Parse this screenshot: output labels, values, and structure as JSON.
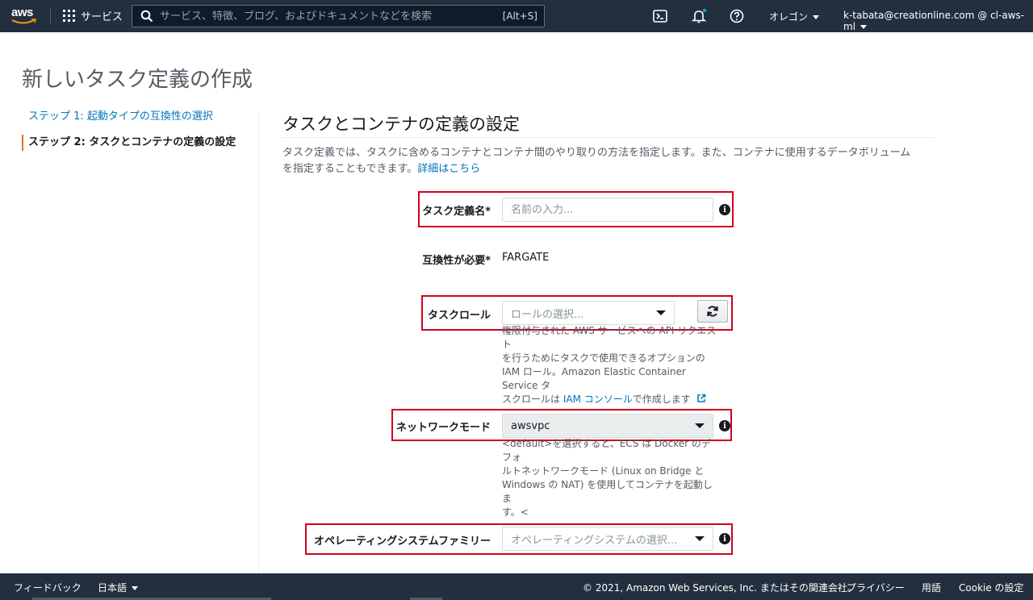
{
  "nav": {
    "logo_text": "aws",
    "services_label": "サービス",
    "search_placeholder": "サービス、特徴、ブログ、およびドキュメントなどを検索",
    "search_shortcut": "[Alt+S]",
    "region": "オレゴン",
    "account": "k-tabata@creationline.com @ cl-aws-ml",
    "icons": [
      "cloudshell-icon",
      "notifications-bell-icon",
      "help-icon"
    ],
    "notification_dot_color": "#00a1c9"
  },
  "page": {
    "title": "新しいタスク定義の作成"
  },
  "steps": {
    "step1": "ステップ 1: 起動タイプの互換性の選択",
    "step2": "ステップ 2: タスクとコンテナの定義の設定"
  },
  "section": {
    "title": "タスクとコンテナの定義の設定",
    "description": "タスク定義では、タスクに含めるコンテナとコンテナ間のやり取りの方法を指定します。また、コンテナに使用するデータボリューム",
    "description_line2": "を指定することもできます。",
    "details_link": "詳細はこちら"
  },
  "form": {
    "task_def_name": {
      "label": "タスク定義名*",
      "placeholder": "名前の入力...",
      "value": ""
    },
    "compatibility": {
      "label": "互換性が必要*",
      "value": "FARGATE"
    },
    "task_role": {
      "label": "タスクロール",
      "placeholder": "ロールの選択...",
      "help_l1": "権限付与された AWS サービスへの API リクエスト",
      "help_l2": "を行うためにタスクで使用できるオプションの",
      "help_l3": "IAM ロール。Amazon Elastic Container Service タ",
      "help_l4_pre": "スクロールは ",
      "help_link": "IAM コンソール",
      "help_l4_post": "で作成します"
    },
    "network_mode": {
      "label": "ネットワークモード",
      "value": "awsvpc",
      "help_l1": "<default>を選択すると、ECS は Docker のデフォ",
      "help_l2": "ルトネットワークモード (Linux on Bridge と",
      "help_l3": "Windows の NAT) を使用してコンテナを起動しま",
      "help_l4": "す。<"
    },
    "os_family": {
      "label": "オペレーティングシステムファミリー",
      "placeholder": "オペレーティングシステムの選択..."
    },
    "highlight_color": "#d0021b"
  },
  "footer": {
    "feedback": "フィードバック",
    "language": "日本語",
    "copyright": "© 2021, Amazon Web Services, Inc. またはその関連会社。",
    "privacy": "プライバシー",
    "terms": "用語",
    "cookie": "Cookie の設定"
  }
}
